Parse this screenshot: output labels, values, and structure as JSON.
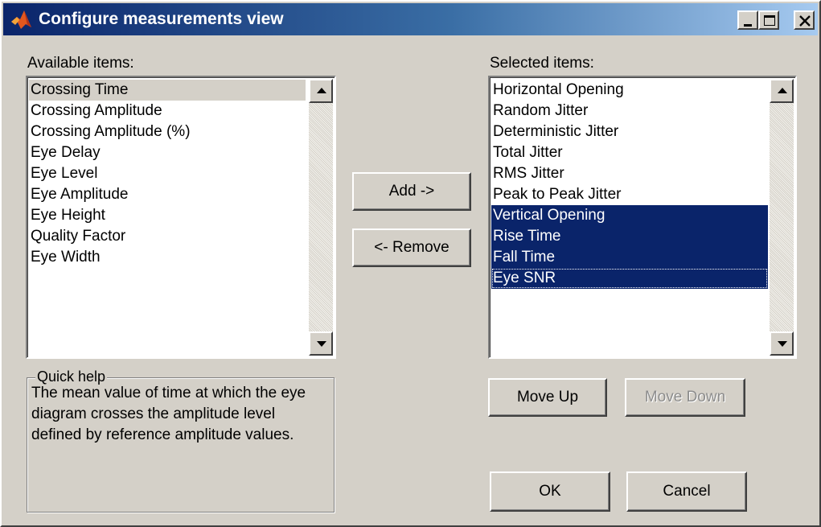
{
  "window": {
    "title": "Configure measurements view"
  },
  "available": {
    "label": "Available items:",
    "items": [
      "Crossing Time",
      "Crossing Amplitude",
      "Crossing Amplitude (%)",
      "Eye Delay",
      "Eye Level",
      "Eye Amplitude",
      "Eye Height",
      "Quality Factor",
      "Eye Width"
    ],
    "highlighted_index": 0
  },
  "selected": {
    "label": "Selected items:",
    "items": [
      "Horizontal Opening",
      "Random Jitter",
      "Deterministic Jitter",
      "Total Jitter",
      "RMS Jitter",
      "Peak to Peak Jitter",
      "Vertical Opening",
      "Rise Time",
      "Fall Time",
      "Eye SNR"
    ],
    "selected_indices": [
      6,
      7,
      8,
      9
    ]
  },
  "buttons": {
    "add": "Add ->",
    "remove": "<- Remove",
    "move_up": "Move Up",
    "move_down": "Move Down",
    "ok": "OK",
    "cancel": "Cancel"
  },
  "quick_help": {
    "legend": "Quick help",
    "text": "The mean value of time at which the eye diagram crosses the amplitude level defined by reference amplitude values."
  },
  "colors": {
    "selection": "#0a246a",
    "face": "#d4d0c8"
  },
  "icons": [
    "matlab-icon",
    "minimize-icon",
    "maximize-icon",
    "close-icon",
    "arrow-up-icon",
    "arrow-down-icon"
  ]
}
